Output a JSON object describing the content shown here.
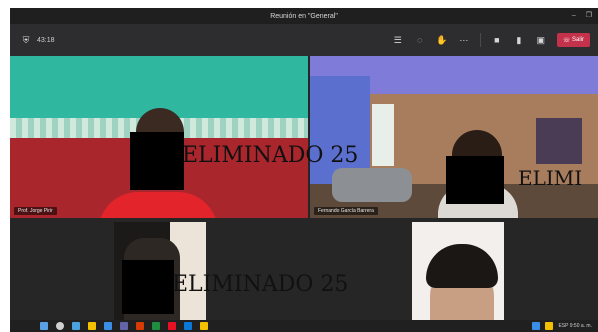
{
  "window": {
    "title": "Reunión en \"General\"",
    "controls": [
      "minimize-icon",
      "maximize-icon"
    ]
  },
  "toolbar": {
    "timer_icon": "shield-icon",
    "timer": "43:18",
    "icons": [
      {
        "name": "participants-icon",
        "glyph": "☰"
      },
      {
        "name": "chat-icon",
        "glyph": "◌"
      },
      {
        "name": "reactions-icon",
        "glyph": "✋"
      },
      {
        "name": "more-icon",
        "glyph": "⋯"
      },
      {
        "name": "camera-icon",
        "glyph": "■"
      },
      {
        "name": "microphone-icon",
        "glyph": "▮"
      },
      {
        "name": "share-icon",
        "glyph": "▣"
      }
    ],
    "leave_label": "Salir",
    "leave_color": "#c4314b"
  },
  "tiles": [
    {
      "id": "tile-1",
      "name_tag": "Prof. Jorge Pirir"
    },
    {
      "id": "tile-2",
      "name_tag": "Fernando García Barrera"
    },
    {
      "id": "tile-3",
      "name_tag": ""
    },
    {
      "id": "tile-4",
      "name_tag": ""
    }
  ],
  "watermarks": [
    "ELIMINADO 25",
    "ELIMI",
    "ELIMINADO 25"
  ],
  "taskbar": {
    "app_colors": [
      "#4aa3df",
      "#f2c200",
      "#3a8ee6",
      "#6264a7",
      "#d83b01",
      "#1e8e3e",
      "#e81123",
      "#0a78d7",
      "#f2c200"
    ],
    "tray_text": "ESP 9:50 a. m."
  },
  "colors": {
    "toolbar_bg": "#2d2d30",
    "title_bg": "#1f1f1f",
    "stage_bg": "#262626"
  }
}
